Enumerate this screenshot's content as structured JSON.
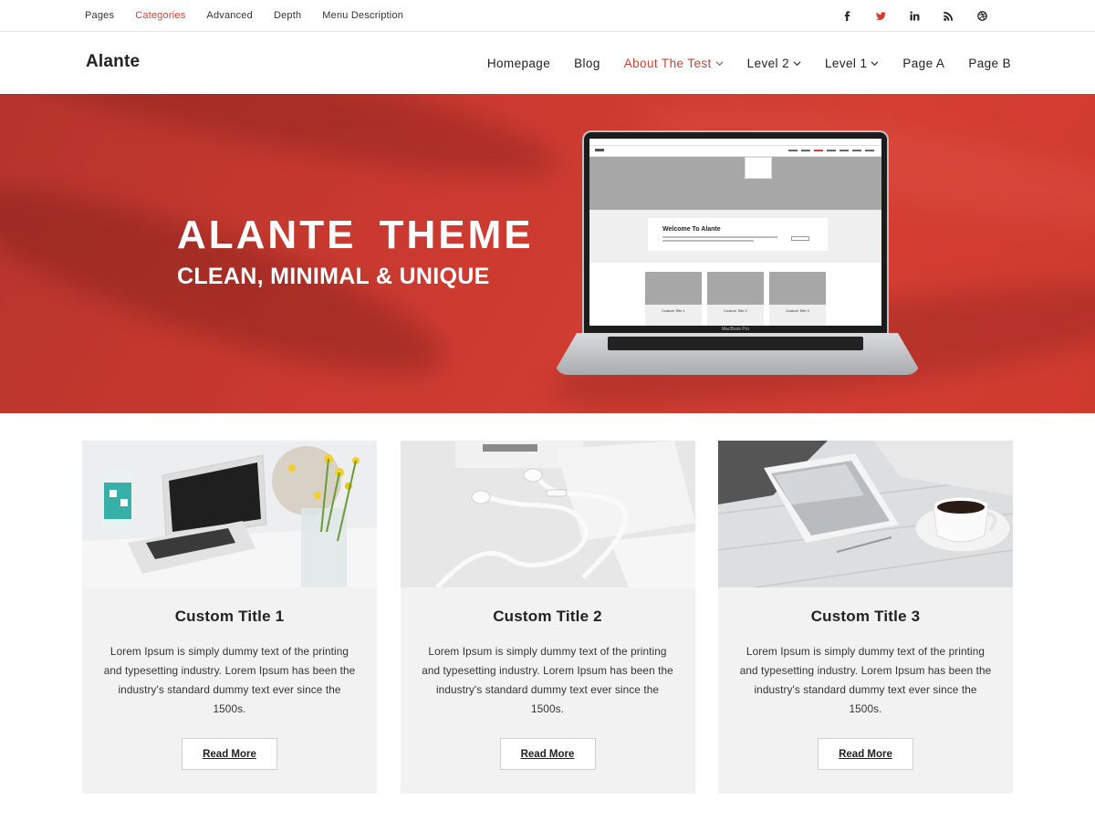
{
  "topbar": {
    "menu": [
      {
        "label": "Pages",
        "active": false
      },
      {
        "label": "Categories",
        "active": true
      },
      {
        "label": "Advanced",
        "active": false
      },
      {
        "label": "Depth",
        "active": false
      },
      {
        "label": "Menu Description",
        "active": false
      }
    ],
    "social_icons": [
      "facebook-icon",
      "twitter-icon",
      "linkedin-icon",
      "rss-icon",
      "dribbble-icon"
    ]
  },
  "header": {
    "logo": "Alante",
    "nav": [
      {
        "label": "Homepage",
        "dropdown": false,
        "active": false
      },
      {
        "label": "Blog",
        "dropdown": false,
        "active": false
      },
      {
        "label": "About The Test",
        "dropdown": true,
        "active": true
      },
      {
        "label": "Level 2",
        "dropdown": true,
        "active": false
      },
      {
        "label": "Level 1",
        "dropdown": true,
        "active": false
      },
      {
        "label": "Page A",
        "dropdown": false,
        "active": false
      },
      {
        "label": "Page B",
        "dropdown": false,
        "active": false
      }
    ]
  },
  "hero": {
    "title": "ALANTE THEME",
    "subtitle": "CLEAN, MINIMAL & UNIQUE",
    "laptop_screen": {
      "welcome_title": "Welcome To Alante",
      "card_titles": [
        "Custom Title 1",
        "Custom Title 2",
        "Custom Title 3"
      ],
      "device_label": "MacBook Pro"
    }
  },
  "cards": [
    {
      "title": "Custom Title 1",
      "text": "Lorem Ipsum is simply dummy text of the printing and typesetting industry. Lorem Ipsum has been the industry's standard dummy text ever since the 1500s.",
      "button": "Read More",
      "image": "laptop-flowers-photo"
    },
    {
      "title": "Custom Title 2",
      "text": "Lorem Ipsum is simply dummy text of the printing and typesetting industry. Lorem Ipsum has been the industry's standard dummy text ever since the 1500s.",
      "button": "Read More",
      "image": "earphones-photo"
    },
    {
      "title": "Custom Title 3",
      "text": "Lorem Ipsum is simply dummy text of the printing and typesetting industry. Lorem Ipsum has been the industry's standard dummy text ever since the 1500s.",
      "button": "Read More",
      "image": "tablet-coffee-photo"
    }
  ],
  "colors": {
    "accent": "#d23f32",
    "hero_bg": "#cf3a2f",
    "card_bg": "#f2f2f2"
  }
}
